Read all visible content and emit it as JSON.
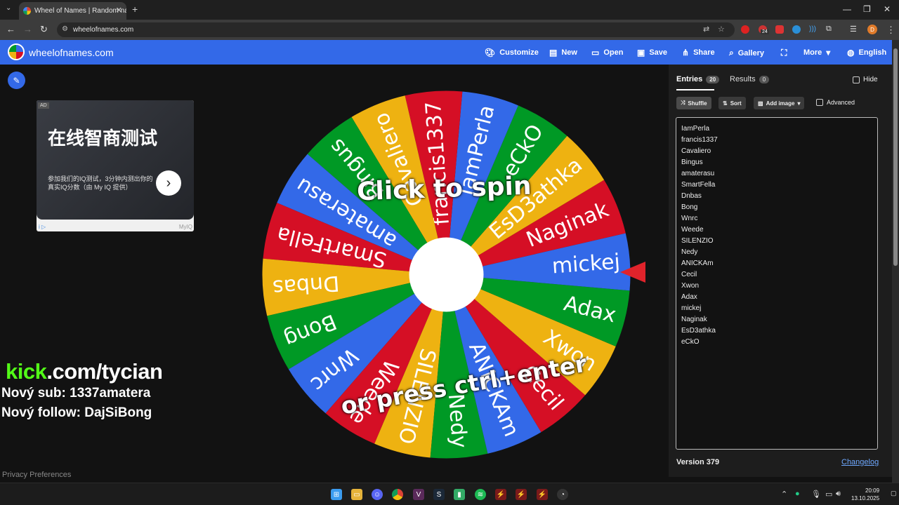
{
  "browser": {
    "tab_title": "Wheel of Names | Random nam",
    "url": "wheelofnames.com",
    "profile_initial": "D",
    "notification_count": "24"
  },
  "site": {
    "title": "wheelofnames.com",
    "menu": [
      {
        "label": "Customize",
        "icon": "palette-icon"
      },
      {
        "label": "New",
        "icon": "file-icon"
      },
      {
        "label": "Open",
        "icon": "folder-icon"
      },
      {
        "label": "Save",
        "icon": "save-icon"
      },
      {
        "label": "Share",
        "icon": "share-icon"
      },
      {
        "label": "Gallery",
        "icon": "search-icon"
      },
      {
        "label": "",
        "icon": "fullscreen-icon"
      },
      {
        "label": "More",
        "icon": "chevron-down-icon"
      },
      {
        "label": "English",
        "icon": "globe-icon"
      }
    ]
  },
  "ad": {
    "tag": "AD",
    "headline": "在线智商测试",
    "body": "参加我们的IQ测试，3分钟内测出你的真实IQ分数（由 My IQ 提供）",
    "brand": "MyIQ"
  },
  "overlay": {
    "kick": "kick",
    "kick_rest": ".com/tycian",
    "sub_line": "Nový sub: 1337amatera",
    "follow_line": "Nový follow: DajSiBong"
  },
  "privacy_link": "Privacy Preferences",
  "wheel": {
    "caption_top": "Click to spin",
    "caption_bottom": "or press ctrl+enter",
    "colors": [
      "#3369e8",
      "#d50f25",
      "#eeb211",
      "#009925"
    ],
    "segments": [
      "Naginak",
      "EsD3athka",
      "eCkO",
      "IamPerla",
      "francis1337",
      "Cavaliero",
      "Bingus",
      "amaterasu",
      "SmartFella",
      "Dnbas",
      "Bong",
      "Wnrc",
      "Weede",
      "SILENZIO",
      "Nedy",
      "ANICKAm",
      "Cecil",
      "Xwon",
      "Adax",
      "mickej"
    ]
  },
  "panel": {
    "tab_entries": "Entries",
    "entries_count": "20",
    "tab_results": "Results",
    "results_count": "0",
    "hide_label": "Hide",
    "shuffle_label": "Shuffle",
    "sort_label": "Sort",
    "add_image_label": "Add image",
    "advanced_label": "Advanced",
    "entries": [
      "IamPerla",
      "francis1337",
      "Cavaliero",
      "Bingus",
      "amaterasu",
      "SmartFella",
      "Dnbas",
      "Bong",
      "Wnrc",
      "Weede",
      "SILENZIO",
      "Nedy",
      "ANICKAm",
      "Cecil",
      "Xwon",
      "Adax",
      "mickej",
      "Naginak",
      "EsD3athka",
      "eCkO"
    ],
    "version": "Version 379",
    "changelog": "Changelog"
  },
  "taskbar": {
    "time": "20:09",
    "date": "13.10.2025"
  }
}
